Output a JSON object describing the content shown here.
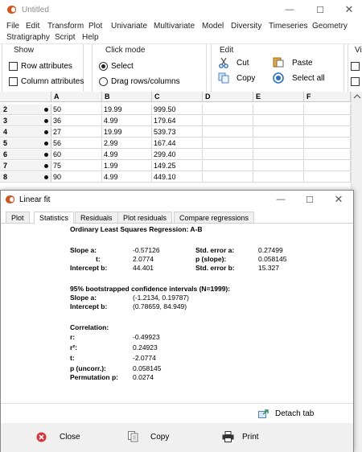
{
  "window": {
    "title": "Untitled"
  },
  "menu": [
    "File",
    "Edit",
    "Transform",
    "Plot",
    "Univariate",
    "Multivariate",
    "Model",
    "Diversity",
    "Timeseries",
    "Geometry",
    "Stratigraphy",
    "Script",
    "Help"
  ],
  "toolbar": {
    "show": {
      "title": "Show",
      "row_attr": "Row attributes",
      "col_attr": "Column attributes"
    },
    "click_mode": {
      "title": "Click mode",
      "select": "Select",
      "drag": "Drag rows/columns",
      "selected": "Select"
    },
    "edit": {
      "title": "Edit",
      "cut": "Cut",
      "copy": "Copy",
      "paste": "Paste",
      "select_all": "Select all"
    },
    "view_title": "Vi"
  },
  "grid": {
    "columns": [
      "",
      "A",
      "B",
      "C",
      "D",
      "E",
      "F"
    ],
    "rows": [
      {
        "n": "2",
        "A": "50",
        "B": "19.99",
        "C": "999.50"
      },
      {
        "n": "3",
        "A": "36",
        "B": "4.99",
        "C": "179.64"
      },
      {
        "n": "4",
        "A": "27",
        "B": "19.99",
        "C": "539.73"
      },
      {
        "n": "5",
        "A": "56",
        "B": "2.99",
        "C": "167.44"
      },
      {
        "n": "6",
        "A": "60",
        "B": "4.99",
        "C": "299.40"
      },
      {
        "n": "7",
        "A": "75",
        "B": "1.99",
        "C": "149.25"
      },
      {
        "n": "8",
        "A": "90",
        "B": "4.99",
        "C": "449.10"
      }
    ]
  },
  "dialog": {
    "title": "Linear fit",
    "tabs": [
      "Plot",
      "Statistics",
      "Residuals",
      "Plot residuals",
      "Compare regressions"
    ],
    "active_tab": "Statistics",
    "heading": "Ordinary Least Squares Regression: A-B",
    "slope_label": "Slope a:",
    "slope": "-0.57126",
    "t_label": "t:",
    "t_val": "2.0774",
    "intercept_label": "Intercept b:",
    "intercept": "44.401",
    "std_a_label": "Std. error a:",
    "std_a": "0.27499",
    "p_slope_label": "p (slope):",
    "p_slope": "0.058145",
    "std_b_label": "Std. error b:",
    "std_b": "15.327",
    "ci_heading": "95% bootstrapped confidence intervals (N=1999):",
    "ci_slope_label": "Slope a:",
    "ci_slope": "(-1.2134, 0.19787)",
    "ci_int_label": "Intercept b:",
    "ci_int": "(0.78659, 84.949)",
    "corr_heading": "Correlation:",
    "r_label": "r:",
    "r": "-0.49923",
    "r2_label": "r²:",
    "r2": "0.24923",
    "tc_label": "t:",
    "tc": "-2.0774",
    "p_unc_label": "p (uncorr.):",
    "p_unc": "0.058145",
    "perm_label": "Permutation p:",
    "perm": "0.0274",
    "detach": "Detach tab",
    "close": "Close",
    "copy": "Copy",
    "print": "Print"
  }
}
